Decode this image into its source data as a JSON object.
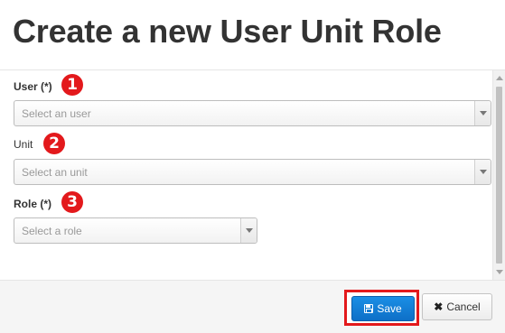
{
  "dialog": {
    "title": "Create a new User Unit Role"
  },
  "form": {
    "user": {
      "label": "User (*)",
      "placeholder": "Select an user",
      "annotation": "1"
    },
    "unit": {
      "label": "Unit",
      "placeholder": "Select an unit",
      "annotation": "2"
    },
    "role": {
      "label": "Role (*)",
      "placeholder": "Select a role",
      "annotation": "3"
    }
  },
  "footer": {
    "save_label": "Save",
    "cancel_label": "Cancel",
    "save_icon": "floppy-disk-icon",
    "cancel_icon": "close-icon"
  },
  "colors": {
    "primary": "#1a8fe5",
    "annotation": "#e3191c",
    "highlight_border": "#e3191c"
  }
}
